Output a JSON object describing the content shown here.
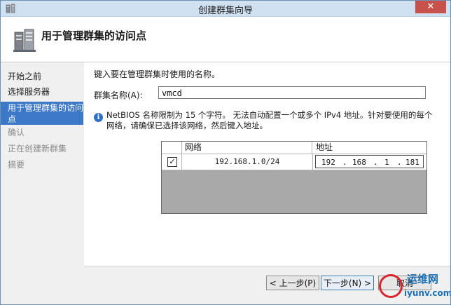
{
  "window": {
    "title": "创建群集向导",
    "close_glyph": "✕"
  },
  "header": {
    "title": "用于管理群集的访问点",
    "icon": "cluster-server-icon"
  },
  "sidebar": {
    "items": [
      {
        "label": "开始之前",
        "state": "normal"
      },
      {
        "label": "选择服务器",
        "state": "normal"
      },
      {
        "label": "用于管理群集的访问",
        "label2": "点",
        "state": "active"
      },
      {
        "label": "确认",
        "state": "disabled"
      },
      {
        "label": "正在创建新群集",
        "state": "disabled"
      },
      {
        "label": "摘要",
        "state": "disabled"
      }
    ]
  },
  "main": {
    "prompt": "键入要在管理群集时使用的名称。",
    "name_label": "群集名称(A):",
    "name_value": "vmcd",
    "info_icon": "info-icon",
    "info_text": "NetBIOS 名称限制为 15 个字符。 无法自动配置一个或多个 IPv4 地址。针对要使用的每个网络，请确保已选择该网络，然后键入地址。",
    "grid": {
      "headers": {
        "network": "网络",
        "address": "地址"
      },
      "rows": [
        {
          "checked": "✓",
          "network": "192.168.1.0/24",
          "octets": [
            "192",
            "168",
            "1",
            "181"
          ],
          "dot": "."
        }
      ]
    }
  },
  "footer": {
    "prev": "< 上一步(P)",
    "next": "下一步(N) >",
    "cancel": "取消"
  },
  "watermark": {
    "cn": "运维网",
    "url": "iyunv.com"
  },
  "colors": {
    "accent": "#3e79c7",
    "titlebar": "#cfe0f1",
    "close": "#c7514b"
  }
}
